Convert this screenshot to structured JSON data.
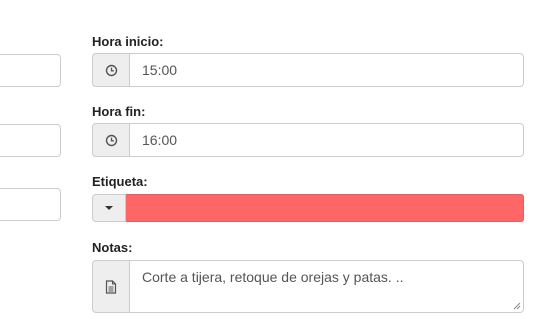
{
  "form": {
    "hora_inicio": {
      "label": "Hora inicio:",
      "value": "15:00",
      "icon": "clock-icon"
    },
    "hora_fin": {
      "label": "Hora fin:",
      "value": "16:00",
      "icon": "clock-icon"
    },
    "etiqueta": {
      "label": "Etiqueta:",
      "color": "#ff6666",
      "icon": "caret-down-icon"
    },
    "notas": {
      "label": "Notas:",
      "value": "Corte a tijera, retoque de orejas y patas. ..",
      "icon": "document-icon"
    }
  }
}
